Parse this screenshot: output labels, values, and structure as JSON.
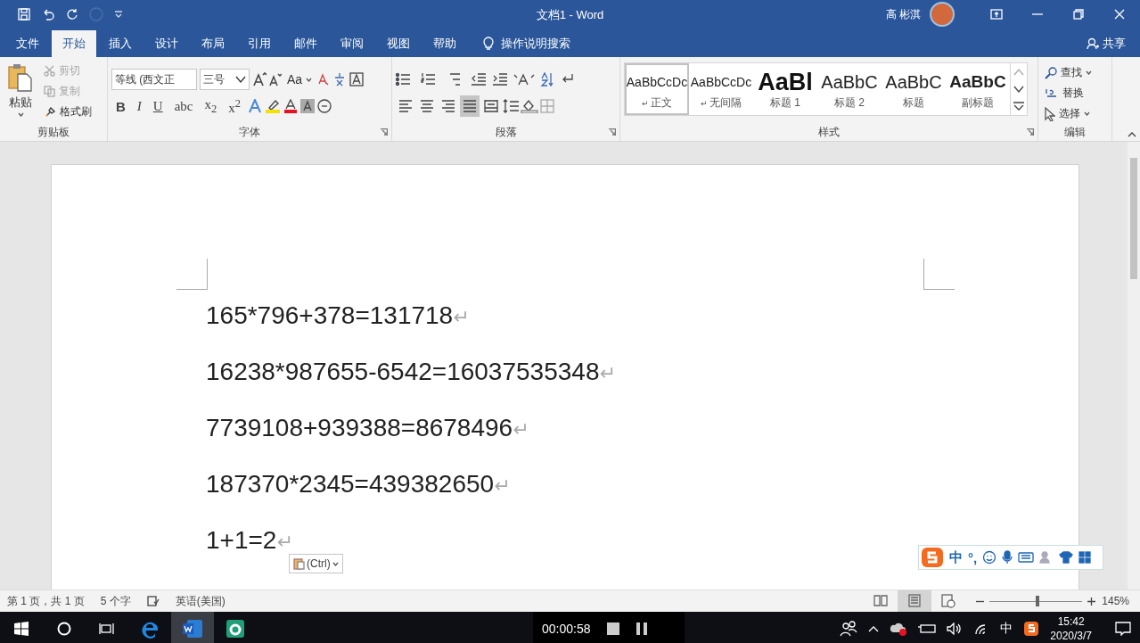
{
  "window": {
    "title": "文档1  -  Word",
    "user": "高 彬淇"
  },
  "tabs": [
    {
      "label": "文件",
      "selected": false
    },
    {
      "label": "开始",
      "selected": true
    },
    {
      "label": "插入",
      "selected": false
    },
    {
      "label": "设计",
      "selected": false
    },
    {
      "label": "布局",
      "selected": false
    },
    {
      "label": "引用",
      "selected": false
    },
    {
      "label": "邮件",
      "selected": false
    },
    {
      "label": "审阅",
      "selected": false
    },
    {
      "label": "视图",
      "selected": false
    },
    {
      "label": "帮助",
      "selected": false
    }
  ],
  "tell_me": "操作说明搜索",
  "share": "共享",
  "clipboard": {
    "label": "剪贴板",
    "paste": "粘贴",
    "items": [
      {
        "kind": "cut",
        "label": "剪切",
        "disabled": true
      },
      {
        "kind": "copy",
        "label": "复制",
        "disabled": true
      },
      {
        "kind": "painter",
        "label": "格式刷",
        "disabled": false
      }
    ]
  },
  "font": {
    "label": "字体",
    "family": "等线 (西文正",
    "size": "三号",
    "case_button": "Aa",
    "format_buttons": [
      "B",
      "I",
      "U",
      "abc",
      "x$_{2}$",
      "x$^{2}$"
    ]
  },
  "paragraph": {
    "label": "段落",
    "align_buttons": [
      {
        "kind": "left",
        "selected": false
      },
      {
        "kind": "center",
        "selected": false
      },
      {
        "kind": "right",
        "selected": false
      },
      {
        "kind": "justify",
        "selected": true
      },
      {
        "kind": "distributed",
        "selected": false
      }
    ]
  },
  "styles": {
    "label": "样式",
    "items": [
      {
        "kind": "normal",
        "preview": "AaBbCcDc",
        "name": "正文",
        "mark": "↵",
        "selected": true
      },
      {
        "kind": "normal",
        "preview": "AaBbCcDc",
        "name": "无间隔",
        "mark": "↵",
        "selected": false
      },
      {
        "kind": "heading1",
        "preview": "AaBl",
        "name": "标题 1",
        "selected": false
      },
      {
        "kind": "heading2",
        "preview": "AaBbC",
        "name": "标题 2",
        "selected": false
      },
      {
        "kind": "title",
        "preview": "AaBbC",
        "name": "标题",
        "selected": false
      },
      {
        "kind": "subtitle",
        "preview": "AaBbC",
        "name": "副标题",
        "selected": false
      }
    ]
  },
  "editing": {
    "label": "编辑",
    "items": [
      {
        "kind": "find",
        "label": "查找"
      },
      {
        "kind": "replace",
        "label": "替换"
      },
      {
        "kind": "select",
        "label": "选择"
      }
    ]
  },
  "document": {
    "lines": [
      {
        "text": "165*796+378=131718",
        "mark": "↵"
      },
      {
        "text": "16238*987655-6542=16037535348",
        "mark": "↵"
      },
      {
        "text": "7739108+939388=8678496",
        "mark": "↵"
      },
      {
        "text": "187370*2345=439382650",
        "mark": "↵"
      },
      {
        "text": "1+1=2",
        "mark": "↵"
      }
    ],
    "paste_options": "(Ctrl)"
  },
  "ime_toolbar": {
    "mode": "中",
    "punctuation": "°,"
  },
  "status_bar": {
    "page": "第 1 页，共 1 页",
    "words": "5 个字",
    "language": "英语(美国)",
    "views": [
      {
        "kind": "read",
        "selected": false
      },
      {
        "kind": "print",
        "selected": true
      },
      {
        "kind": "web",
        "selected": false
      }
    ],
    "zoom_slider": {
      "level": 0.52
    },
    "zoom": "145%"
  },
  "taskbar": {
    "apps": [
      {
        "kind": "edge",
        "selected": false
      },
      {
        "kind": "word",
        "selected": true
      },
      {
        "kind": "capture",
        "selected": false
      }
    ],
    "recording_time": "00:00:58",
    "ime": "中",
    "time": "15:42",
    "date": "2020/3/7"
  }
}
